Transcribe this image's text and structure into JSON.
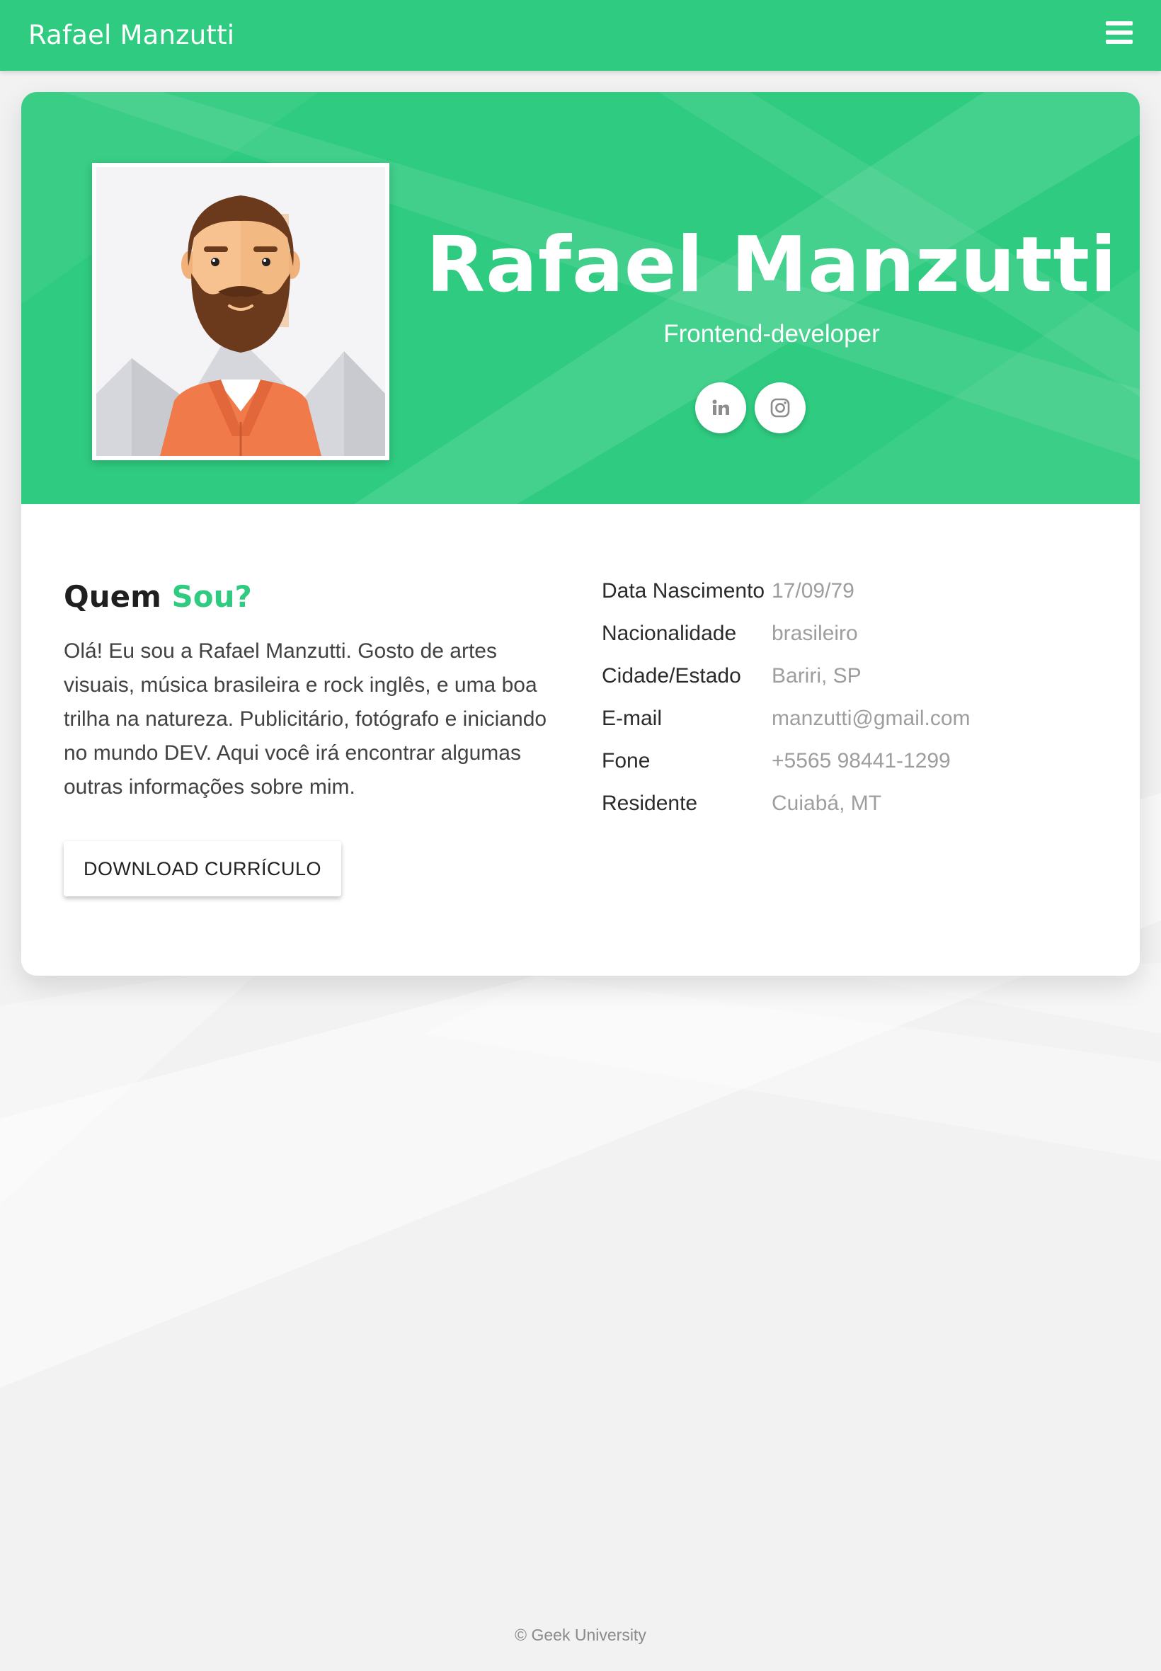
{
  "topbar": {
    "brand": "Rafael Manzutti",
    "menu_icon": "hamburger-menu-icon"
  },
  "hero": {
    "name": "Rafael Manzutti",
    "role": "Frontend-developer",
    "avatar": "bearded-man-avatar",
    "social": [
      {
        "icon": "linkedin-icon",
        "label": "LinkedIn"
      },
      {
        "icon": "instagram-icon",
        "label": "Instagram"
      }
    ]
  },
  "about": {
    "title_prefix": "Quem",
    "title_accent": "Sou?",
    "text": "Olá! Eu sou a Rafael Manzutti. Gosto de artes visuais, música brasileira e rock inglês, e uma boa trilha na natureza. Publicitário, fotógrafo e iniciando no mundo DEV. Aqui você irá encontrar algumas outras informações sobre mim.",
    "download_label": "DOWNLOAD CURRÍCULO"
  },
  "info": [
    {
      "label": "Data Nascimento",
      "value": "17/09/79"
    },
    {
      "label": "Nacionalidade",
      "value": "brasileiro"
    },
    {
      "label": "Cidade/Estado",
      "value": "Bariri, SP"
    },
    {
      "label": "E-mail",
      "value": "manzutti@gmail.com"
    },
    {
      "label": "Fone",
      "value": "+5565 98441-1299"
    },
    {
      "label": "Residente",
      "value": "Cuiabá, MT"
    }
  ],
  "footer": {
    "text": "© Geek University"
  },
  "colors": {
    "accent": "#2fcb80",
    "background": "#f2f2f2"
  }
}
